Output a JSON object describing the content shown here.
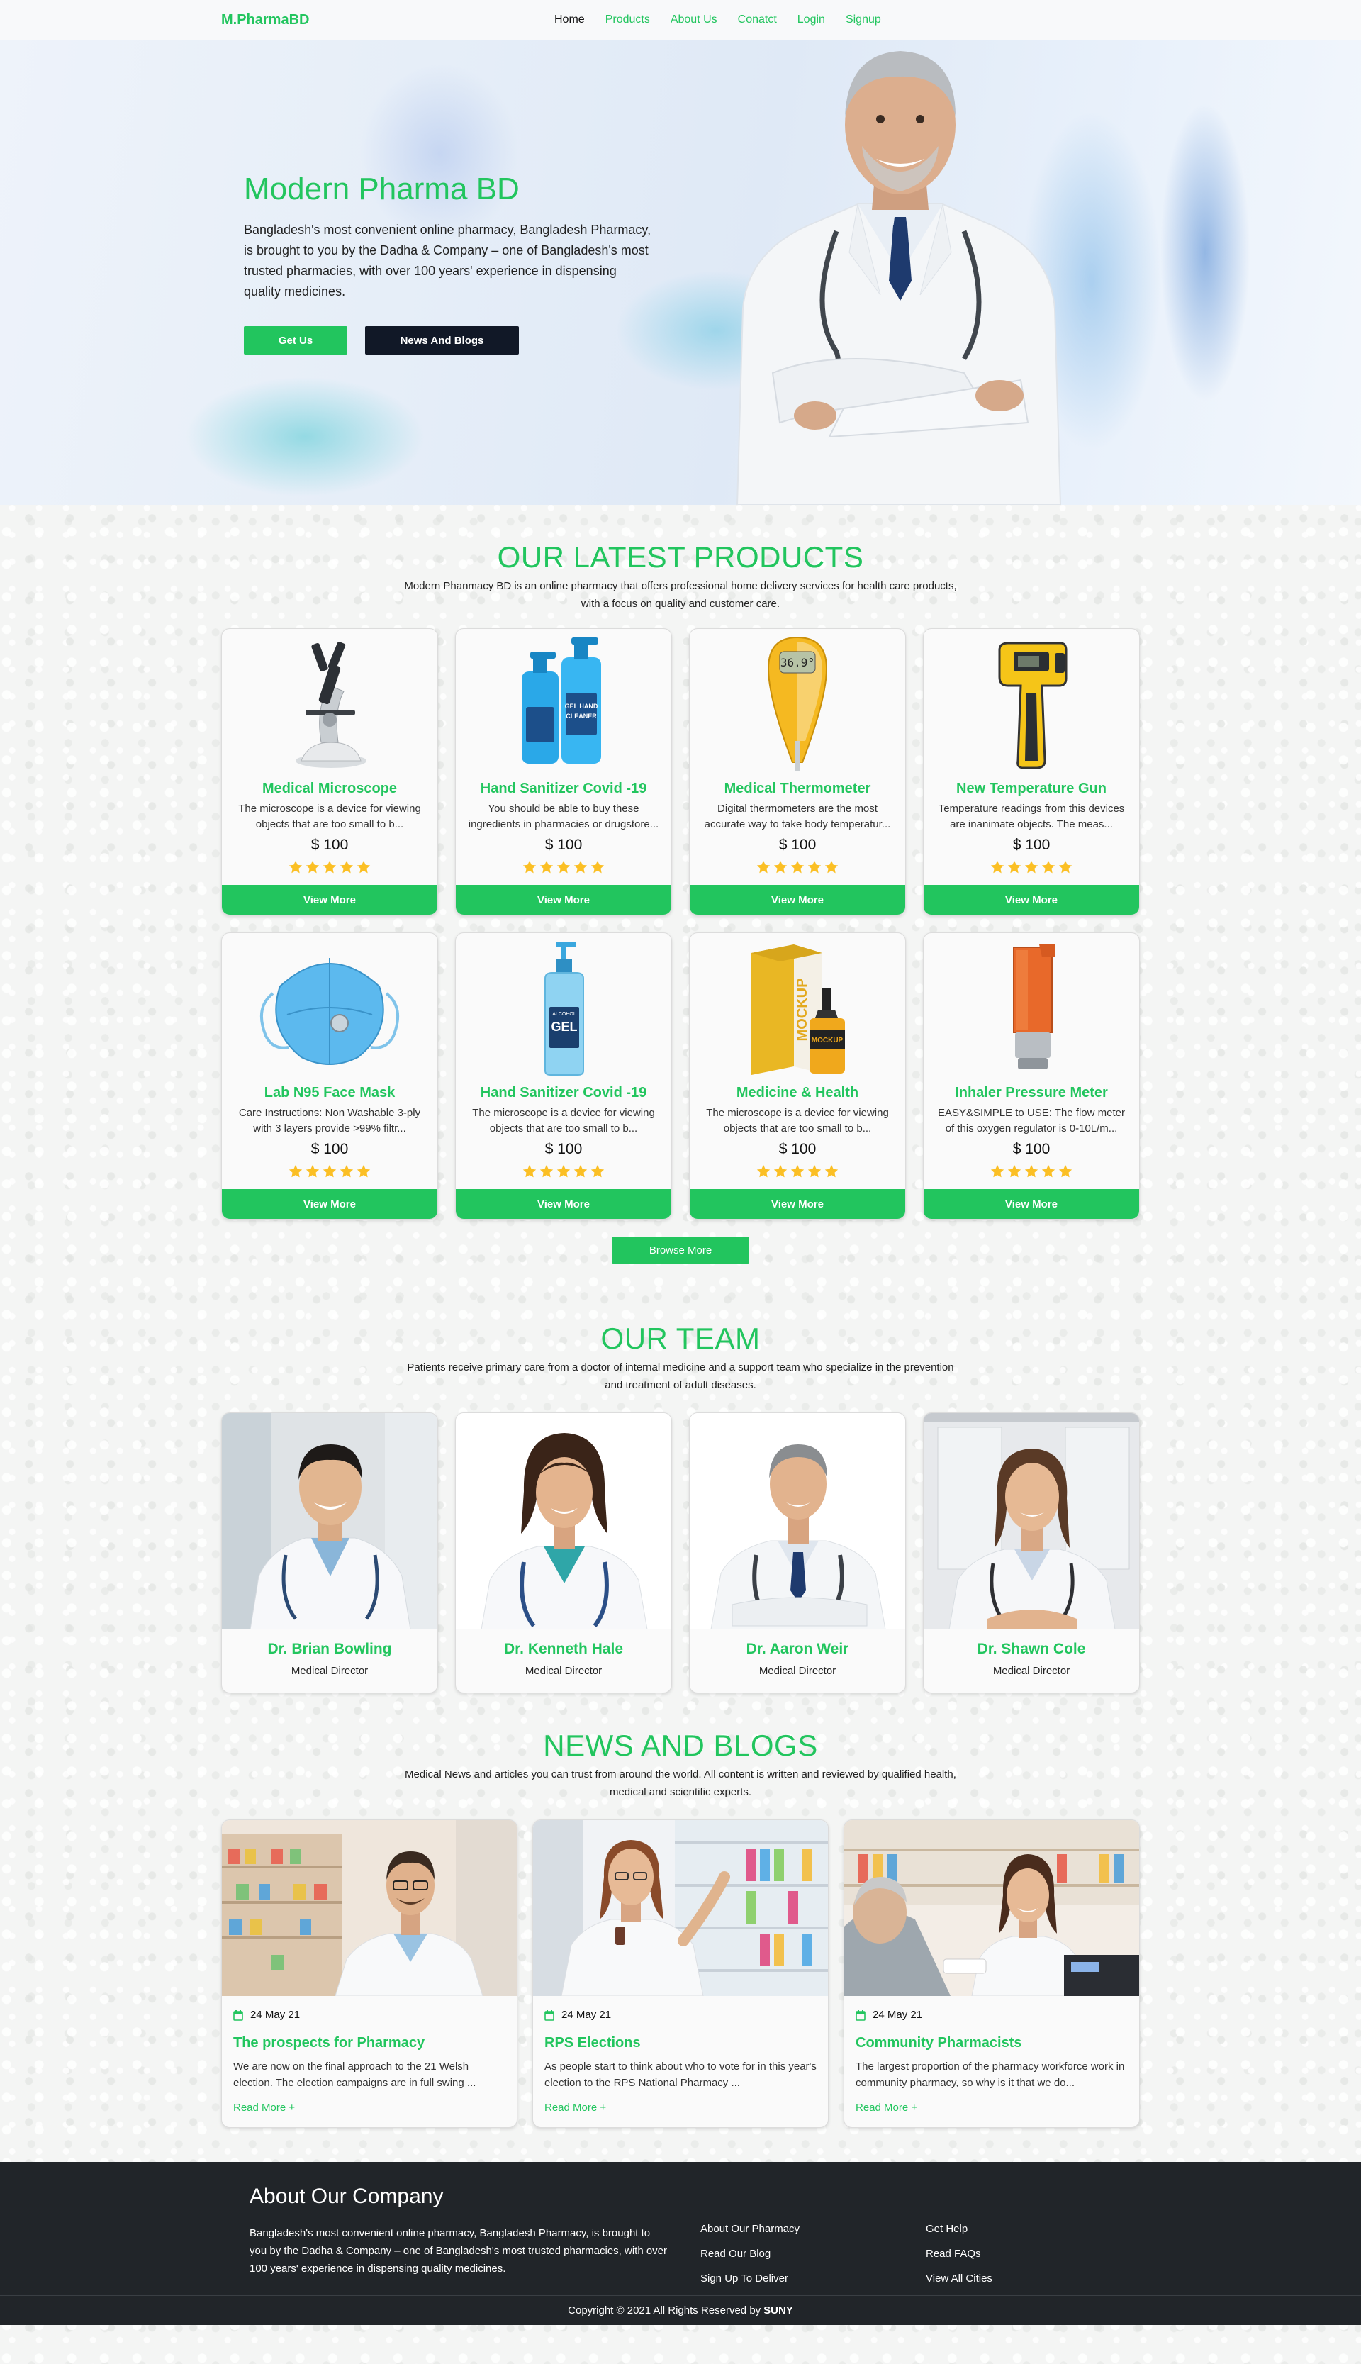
{
  "nav": {
    "brand": "M.PharmaBD",
    "items": [
      {
        "label": "Home"
      },
      {
        "label": "Products"
      },
      {
        "label": "About Us"
      },
      {
        "label": "Conatct"
      },
      {
        "label": "Login"
      },
      {
        "label": "Signup"
      }
    ]
  },
  "hero": {
    "title": "Modern Pharma BD",
    "description": "Bangladesh's most convenient online pharmacy, Bangladesh Pharmacy, is brought to you by the Dadha & Company – one of Bangladesh's most trusted pharmacies, with over 100 years' experience in dispensing quality medicines.",
    "primary_button": "Get Us",
    "secondary_button": "News And Blogs"
  },
  "products": {
    "title": "OUR LATEST PRODUCTS",
    "subtitle": "Modern Phanmacy BD is an online pharmacy that offers professional home delivery services for health care products, with a focus on quality and customer care.",
    "items": [
      {
        "name": "Medical Microscope",
        "description": "The microscope is a device for viewing objects that are too small to b...",
        "price": "$ 100",
        "rating": 5,
        "button": "View More"
      },
      {
        "name": "Hand Sanitizer Covid -19",
        "description": "You should be able to buy these ingredients in pharmacies or drugstore...",
        "price": "$ 100",
        "rating": 5,
        "button": "View More"
      },
      {
        "name": "Medical Thermometer",
        "description": "Digital thermometers are the most accurate way to take body temperatur...",
        "price": "$ 100",
        "rating": 5,
        "button": "View More"
      },
      {
        "name": "New Temperature Gun",
        "description": "Temperature readings from this devices are inanimate objects. The meas...",
        "price": "$ 100",
        "rating": 5,
        "button": "View More"
      },
      {
        "name": "Lab N95 Face Mask",
        "description": "Care Instructions: Non Washable 3-ply with 3 layers provide >99% filtr...",
        "price": "$ 100",
        "rating": 5,
        "button": "View More"
      },
      {
        "name": "Hand Sanitizer Covid -19",
        "description": "The microscope is a device for viewing objects that are too small to b...",
        "price": "$ 100",
        "rating": 5,
        "button": "View More"
      },
      {
        "name": "Medicine & Health",
        "description": "The microscope is a device for viewing objects that are too small to b...",
        "price": "$ 100",
        "rating": 5,
        "button": "View More"
      },
      {
        "name": "Inhaler Pressure Meter",
        "description": "EASY&SIMPLE to USE: The flow meter of this oxygen regulator is 0-10L/m...",
        "price": "$ 100",
        "rating": 5,
        "button": "View More"
      }
    ],
    "browse_button": "Browse More",
    "image_labels": {
      "thermometer_display": "36.9°",
      "sanitizer_text": "GEL HAND CLEANER",
      "gel_text": "GEL",
      "gel_sub": "ALCOHOL",
      "mockup_text": "MOCKUP"
    }
  },
  "team": {
    "title": "OUR TEAM",
    "subtitle": "Patients receive primary care from a doctor of internal medicine and a support team who specialize in the prevention and treatment of adult diseases.",
    "members": [
      {
        "name": "Dr. Brian Bowling",
        "role": "Medical Director"
      },
      {
        "name": "Dr. Kenneth Hale",
        "role": "Medical Director"
      },
      {
        "name": "Dr. Aaron Weir",
        "role": "Medical Director"
      },
      {
        "name": "Dr. Shawn Cole",
        "role": "Medical Director"
      }
    ]
  },
  "news": {
    "title": "NEWS AND BLOGS",
    "subtitle": "Medical News and articles you can trust from around the world. All content is written and reviewed by qualified health, medical and scientific experts.",
    "posts": [
      {
        "date": "24 May 21",
        "title": "The prospects for Pharmacy",
        "excerpt": "We are now on the final approach to the 21 Welsh election. The election campaigns are in full swing ...",
        "link": "Read More +"
      },
      {
        "date": "24 May 21",
        "title": "RPS Elections",
        "excerpt": "As people start to think about who to vote for in this year's election to the RPS National Pharmacy ...",
        "link": "Read More +"
      },
      {
        "date": "24 May 21",
        "title": "Community Pharmacists",
        "excerpt": "The largest proportion of the pharmacy workforce work in community pharmacy, so why is it that we do...",
        "link": "Read More +"
      }
    ]
  },
  "footer": {
    "about_title": "About Our Company",
    "about_text": "Bangladesh's most convenient online pharmacy, Bangladesh Pharmacy, is brought to you by the Dadha & Company – one of Bangladesh's most trusted pharmacies, with over 100 years' experience in dispensing quality medicines.",
    "links_col1": [
      "About Our Pharmacy",
      "Read Our Blog",
      "Sign Up To Deliver"
    ],
    "links_col2": [
      "Get Help",
      "Read FAQs",
      "View All Cities"
    ],
    "copyright": "Copyright © 2021 All Rights Reserved by",
    "author": "SUNY"
  },
  "colors": {
    "accent": "#22c55e",
    "dark": "#111827",
    "footer": "#212529",
    "star": "#fbbf24"
  }
}
